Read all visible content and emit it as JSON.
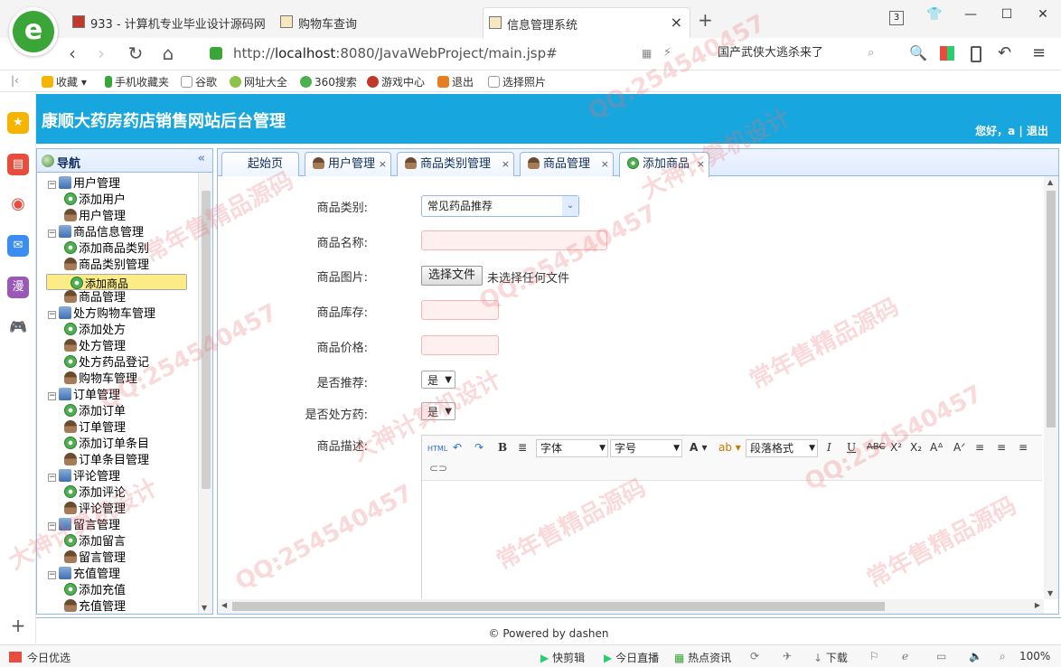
{
  "browser": {
    "tabs": [
      {
        "label": "933 - 计算机专业毕业设计源码网"
      },
      {
        "label": "购物车查询"
      },
      {
        "label": "信息管理系统",
        "close": "×"
      }
    ],
    "new_tab": "+",
    "tab_count": "3",
    "url_scheme": "http://",
    "url_host": "localhost",
    "url_rest": ":8080/JavaWebProject/main.jsp#",
    "search_text": "国产武侠大逃杀来了",
    "bookmarks": [
      "收藏",
      "手机收藏夹",
      "谷歌",
      "网址大全",
      "360搜索",
      "游戏中心",
      "退出",
      "选择照片"
    ]
  },
  "app": {
    "title": "康顺大药房药店销售网站后台管理",
    "greeting": "您好，a",
    "logout": "退出",
    "nav_title": "导航",
    "tree": [
      {
        "label": "用户管理",
        "level": 0
      },
      {
        "label": "添加用户",
        "level": 1,
        "icon": "add"
      },
      {
        "label": "用户管理",
        "level": 1,
        "icon": "user"
      },
      {
        "label": "商品信息管理",
        "level": 0
      },
      {
        "label": "添加商品类别",
        "level": 1,
        "icon": "add"
      },
      {
        "label": "商品类别管理",
        "level": 1,
        "icon": "user"
      },
      {
        "label": "添加商品",
        "level": 1,
        "icon": "add",
        "selected": true
      },
      {
        "label": "商品管理",
        "level": 1,
        "icon": "user"
      },
      {
        "label": "处方购物车管理",
        "level": 0
      },
      {
        "label": "添加处方",
        "level": 1,
        "icon": "add"
      },
      {
        "label": "处方管理",
        "level": 1,
        "icon": "user"
      },
      {
        "label": "处方药品登记",
        "level": 1,
        "icon": "add"
      },
      {
        "label": "购物车管理",
        "level": 1,
        "icon": "user"
      },
      {
        "label": "订单管理",
        "level": 0
      },
      {
        "label": "添加订单",
        "level": 1,
        "icon": "add"
      },
      {
        "label": "订单管理",
        "level": 1,
        "icon": "user"
      },
      {
        "label": "添加订单条目",
        "level": 1,
        "icon": "add"
      },
      {
        "label": "订单条目管理",
        "level": 1,
        "icon": "user"
      },
      {
        "label": "评论管理",
        "level": 0
      },
      {
        "label": "添加评论",
        "level": 1,
        "icon": "add"
      },
      {
        "label": "评论管理",
        "level": 1,
        "icon": "user"
      },
      {
        "label": "留言管理",
        "level": 0
      },
      {
        "label": "添加留言",
        "level": 1,
        "icon": "add"
      },
      {
        "label": "留言管理",
        "level": 1,
        "icon": "user"
      },
      {
        "label": "充值管理",
        "level": 0
      },
      {
        "label": "添加充值",
        "level": 1,
        "icon": "add"
      },
      {
        "label": "充值管理",
        "level": 1,
        "icon": "user"
      }
    ],
    "page_tabs": [
      {
        "label": "起始页",
        "icon": "none"
      },
      {
        "label": "用户管理",
        "icon": "user"
      },
      {
        "label": "商品类别管理",
        "icon": "user"
      },
      {
        "label": "商品管理",
        "icon": "user"
      },
      {
        "label": "添加商品",
        "icon": "add",
        "active": true
      }
    ],
    "form": {
      "category_label": "商品类别:",
      "category_value": "常见药品推荐",
      "name_label": "商品名称:",
      "image_label": "商品图片:",
      "file_button": "选择文件",
      "file_status": "未选择任何文件",
      "stock_label": "商品库存:",
      "price_label": "商品价格:",
      "recommend_label": "是否推荐:",
      "recommend_value": "是",
      "prescription_label": "是否处方药:",
      "prescription_value": "是",
      "desc_label": "商品描述:"
    },
    "editor": {
      "font_family": "字体",
      "font_size": "字号",
      "paragraph": "段落格式",
      "html_btn": "HTML"
    },
    "footer": "© Powered by dashen"
  },
  "statusbar": {
    "left": "今日优选",
    "items": [
      "快剪辑",
      "今日直播",
      "热点资讯",
      "下载"
    ],
    "zoom": "100%"
  },
  "watermarks": [
    "QQ:254540457",
    "常年售精品源码",
    "大神计算机设计"
  ]
}
